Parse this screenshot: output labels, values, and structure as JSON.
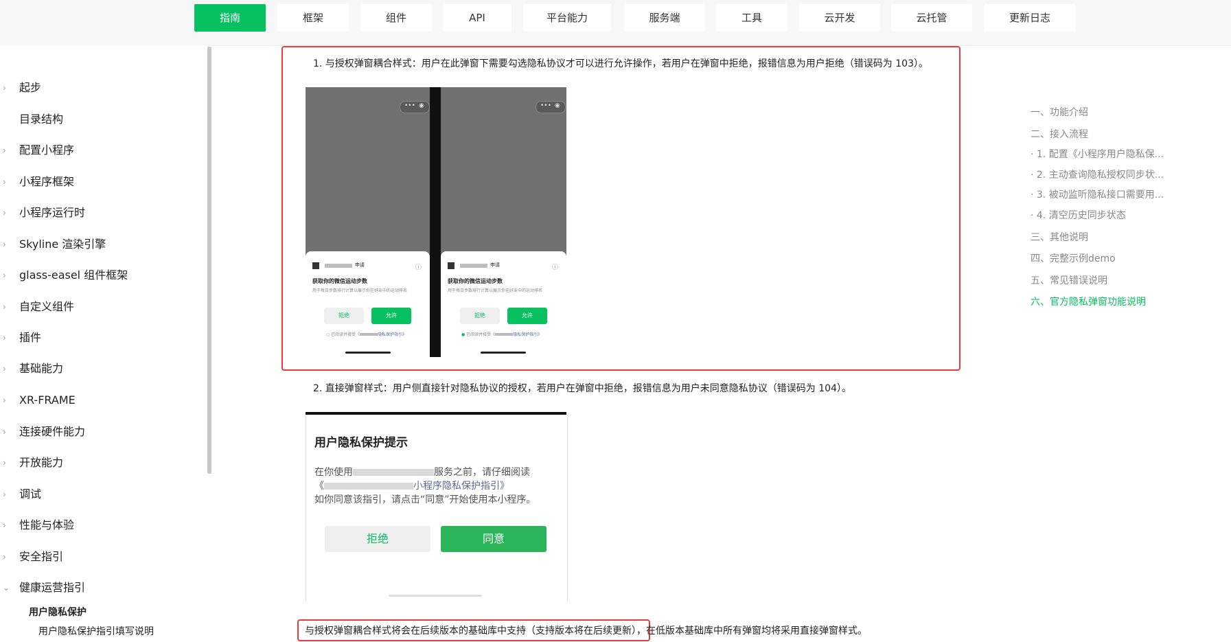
{
  "nav": {
    "tabs": [
      "指南",
      "框架",
      "组件",
      "API",
      "平台能力",
      "服务端",
      "工具",
      "云开发",
      "云托管",
      "更新日志"
    ],
    "active_index": 0,
    "accent": "#07c160"
  },
  "sidebar": {
    "items": [
      {
        "label": "起步",
        "expandable": true
      },
      {
        "label": "目录结构",
        "expandable": false
      },
      {
        "label": "配置小程序",
        "expandable": true
      },
      {
        "label": "小程序框架",
        "expandable": true
      },
      {
        "label": "小程序运行时",
        "expandable": true
      },
      {
        "label": "Skyline 渲染引擎",
        "expandable": true
      },
      {
        "label": "glass-easel 组件框架",
        "expandable": true
      },
      {
        "label": "自定义组件",
        "expandable": true
      },
      {
        "label": "插件",
        "expandable": true
      },
      {
        "label": "基础能力",
        "expandable": true
      },
      {
        "label": "XR-FRAME",
        "expandable": true
      },
      {
        "label": "连接硬件能力",
        "expandable": true
      },
      {
        "label": "开放能力",
        "expandable": true
      },
      {
        "label": "调试",
        "expandable": true
      },
      {
        "label": "性能与体验",
        "expandable": true
      },
      {
        "label": "安全指引",
        "expandable": true
      },
      {
        "label": "健康运营指引",
        "expandable": true,
        "expanded": true
      }
    ],
    "sub_section": "用户隐私保护",
    "sub_item": "用户隐私保护指引填写说明"
  },
  "content": {
    "para1": "1. 与授权弹窗耦合样式：用户在此弹窗下需要勾选隐私协议才可以进行允许操作，若用户在弹窗中拒绝，报错信息为用户拒绝（错误码为 103）。",
    "para2": "2. 直接弹窗样式：用户侧直接针对隐私协议的授权，若用户在弹窗中拒绝，报错信息为用户未同意隐私协议（错误码为 104）。",
    "bottom_highlight": "与授权弹窗耦合样式将会在后续版本的基础库中支持（支持版本将在后续更新）",
    "bottom_rest": "，在低版本基础库中所有弹窗均将采用直接弹窗样式。",
    "mock1": {
      "apply": "申请",
      "title": "获取你的微信运动步数",
      "desc": "用于每日步数排行计算以展示你在好友中的运动排名",
      "reject": "拒绝",
      "allow": "允许",
      "agreement": "已阅读并接受《",
      "agreement_link": "隐私保护指引》"
    },
    "dialog": {
      "title": "用户隐私保护提示",
      "line1_pre": "在你使用",
      "line1_post": "服务之前，请仔细阅读",
      "line2_pre": "《",
      "line2_link": "小程序隐私保护指引》",
      "line3": "如你同意该指引，请点击“同意”开始使用本小程序。",
      "reject": "拒绝",
      "agree": "同意"
    }
  },
  "toc": {
    "items": [
      "一、功能介绍",
      "二、接入流程",
      "· 1. 配置《小程序用户隐私保...",
      "· 2. 主动查询隐私授权同步状...",
      "· 3. 被动监听隐私接口需要用...",
      "· 4. 清空历史同步状态",
      "三、其他说明",
      "四、完整示例demo",
      "五、常见错误说明",
      "六、官方隐私弹窗功能说明"
    ],
    "active_index": 9
  }
}
